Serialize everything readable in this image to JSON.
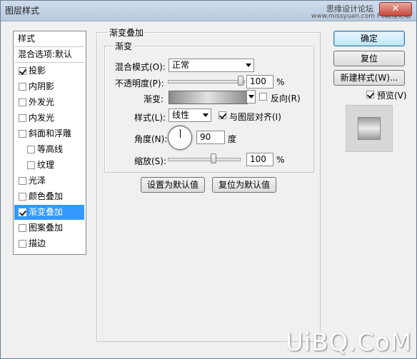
{
  "window": {
    "title": "图层样式",
    "watermark_top": "思缘设计论坛",
    "watermark_top_sub": "www.missyuan.com PS教程论坛",
    "close_glyph": "✕"
  },
  "styles_list": {
    "header": "样式",
    "blend_header": "混合选项:默认",
    "items": [
      {
        "label": "投影",
        "checked": true
      },
      {
        "label": "内阴影",
        "checked": false
      },
      {
        "label": "外发光",
        "checked": false
      },
      {
        "label": "内发光",
        "checked": false
      },
      {
        "label": "斜面和浮雕",
        "checked": false
      },
      {
        "label": "等高线",
        "checked": false
      },
      {
        "label": "纹理",
        "checked": false
      },
      {
        "label": "光泽",
        "checked": false
      },
      {
        "label": "颜色叠加",
        "checked": false
      },
      {
        "label": "渐变叠加",
        "checked": true,
        "selected": true
      },
      {
        "label": "图案叠加",
        "checked": false
      },
      {
        "label": "描边",
        "checked": false
      }
    ]
  },
  "panel": {
    "group_title": "渐变叠加",
    "subgroup_title": "渐变",
    "blend_mode_label": "混合模式(O):",
    "blend_mode_value": "正常",
    "opacity_label": "不透明度(P):",
    "opacity_value": "100",
    "opacity_unit": "%",
    "gradient_label": "渐变:",
    "reverse_label": "反向(R)",
    "reverse_checked": false,
    "style_label": "样式(L):",
    "style_value": "线性",
    "align_label": "与图层对齐(I)",
    "align_checked": true,
    "angle_label": "角度(N):",
    "angle_value": "90",
    "angle_unit": "度",
    "scale_label": "缩放(S):",
    "scale_value": "100",
    "scale_unit": "%",
    "set_default_btn": "设置为默认值",
    "reset_default_btn": "复位为默认值"
  },
  "right": {
    "ok": "确定",
    "reset": "复位",
    "new_style": "新建样式(W)...",
    "preview_label": "预览(V)",
    "preview_checked": true
  },
  "brand_watermark": "UiBQ.CoM"
}
